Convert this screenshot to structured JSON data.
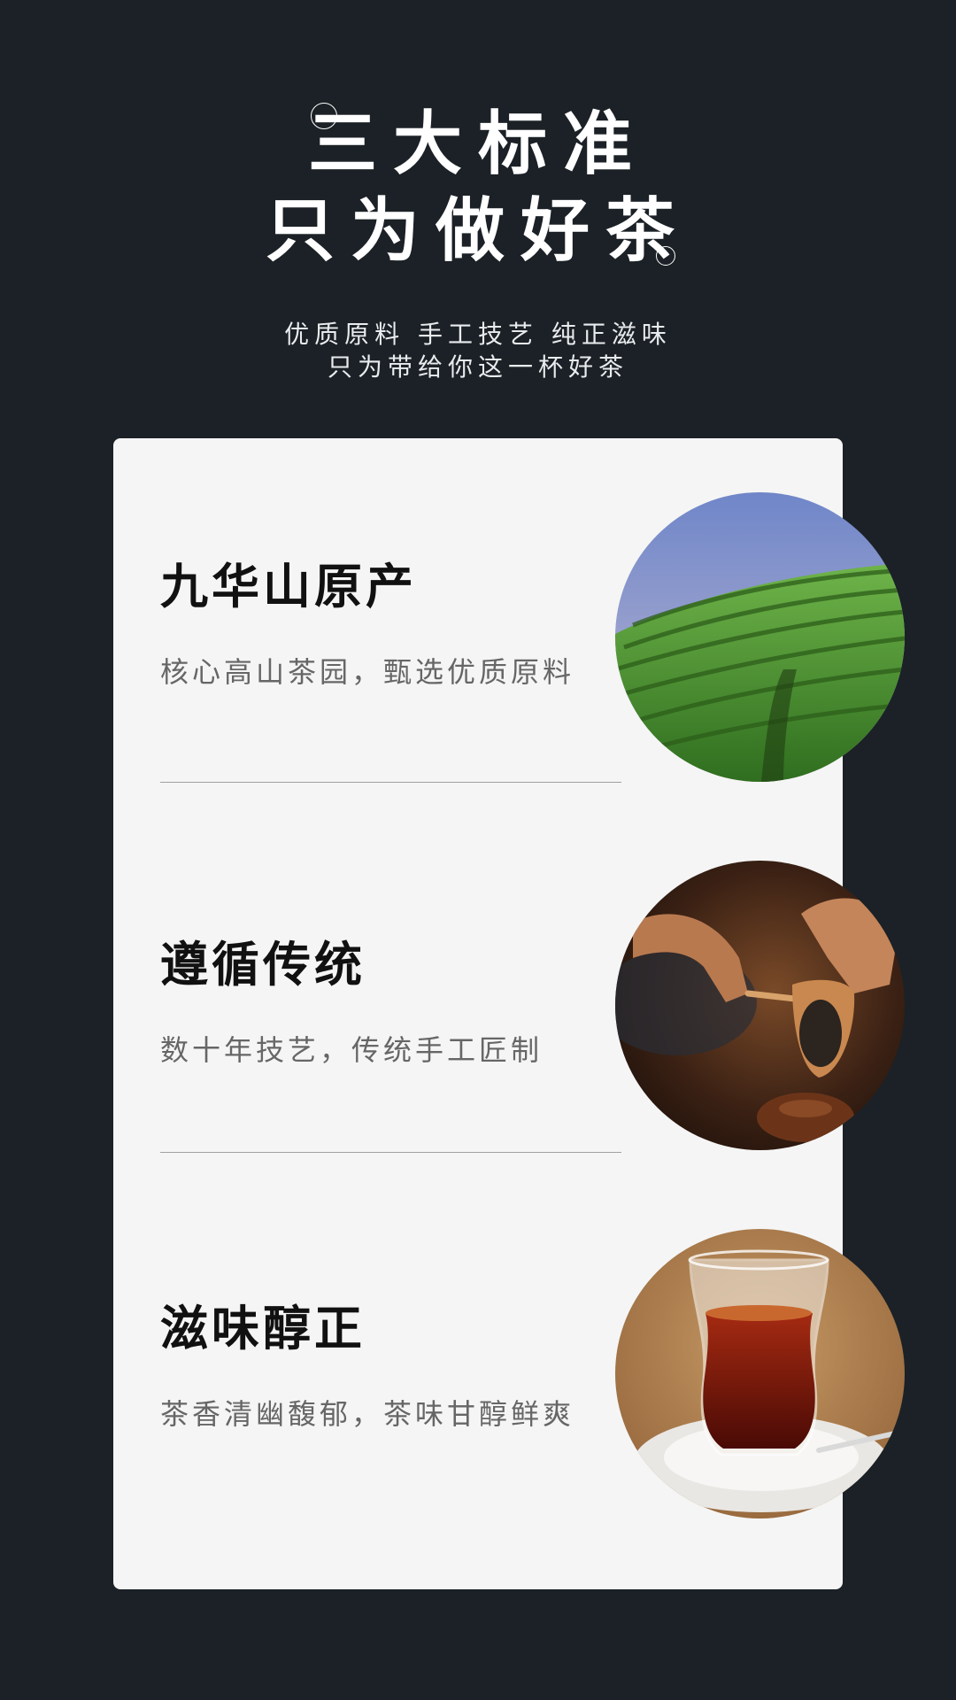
{
  "header": {
    "title_line1": "三大标准",
    "title_line2": "只为做好茶",
    "subtitle_line1": "优质原料 手工技艺 纯正滋味",
    "subtitle_line2": "只为带给你这一杯好茶"
  },
  "features": [
    {
      "title": "九华山原产",
      "desc": "核心高山茶园，甄选优质原料",
      "image": "tea-plantation-photo"
    },
    {
      "title": "遵循传统",
      "desc": "数十年技艺，传统手工匠制",
      "image": "tea-scooping-hands-photo"
    },
    {
      "title": "滋味醇正",
      "desc": "茶香清幽馥郁，茶味甘醇鲜爽",
      "image": "tea-glass-photo"
    }
  ],
  "colors": {
    "background": "#1b2126",
    "card": "#f5f5f5",
    "title": "#111111",
    "desc": "#666666"
  }
}
